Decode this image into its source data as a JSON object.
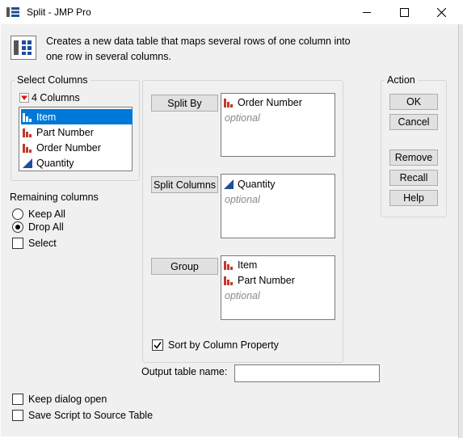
{
  "window": {
    "title": "Split - JMP Pro",
    "minimize_icon": "minimize-icon",
    "maximize_icon": "maximize-icon",
    "close_icon": "close-icon"
  },
  "description": {
    "line1": "Creates a new data table that maps several rows of one column into",
    "line2": "one row in several columns."
  },
  "select_columns": {
    "legend": "Select Columns",
    "count_label": "4 Columns",
    "items": [
      {
        "label": "Item",
        "type": "nominal",
        "selected": true
      },
      {
        "label": "Part Number",
        "type": "nominal",
        "selected": false
      },
      {
        "label": "Order Number",
        "type": "nominal",
        "selected": false
      },
      {
        "label": "Quantity",
        "type": "continuous",
        "selected": false
      }
    ]
  },
  "remaining": {
    "label": "Remaining columns",
    "keep_all": "Keep All",
    "drop_all": "Drop All",
    "selected_option": "Drop All",
    "select": "Select"
  },
  "roles": {
    "split_by": {
      "button": "Split By",
      "items": [
        "Order Number"
      ],
      "hint": "optional"
    },
    "split_columns": {
      "button": "Split Columns",
      "items": [
        "Quantity"
      ],
      "hint": "optional"
    },
    "group": {
      "button": "Group",
      "items": [
        "Item",
        "Part Number"
      ],
      "hint": "optional"
    },
    "sort_by_column_property": {
      "label": "Sort by Column Property",
      "checked": true
    }
  },
  "output": {
    "label": "Output table name:",
    "value": ""
  },
  "action": {
    "legend": "Action",
    "ok": "OK",
    "cancel": "Cancel",
    "remove": "Remove",
    "recall": "Recall",
    "help": "Help"
  },
  "footer": {
    "keep_dialog_open": "Keep dialog open",
    "keep_dialog_open_checked": false,
    "save_script": "Save Script to Source Table",
    "save_script_checked": false
  },
  "colors": {
    "selection": "#0078d7",
    "nominal_icon": "#c0392b",
    "continuous_icon": "#1f4e9e",
    "dialog_bg": "#f0f0f0"
  }
}
